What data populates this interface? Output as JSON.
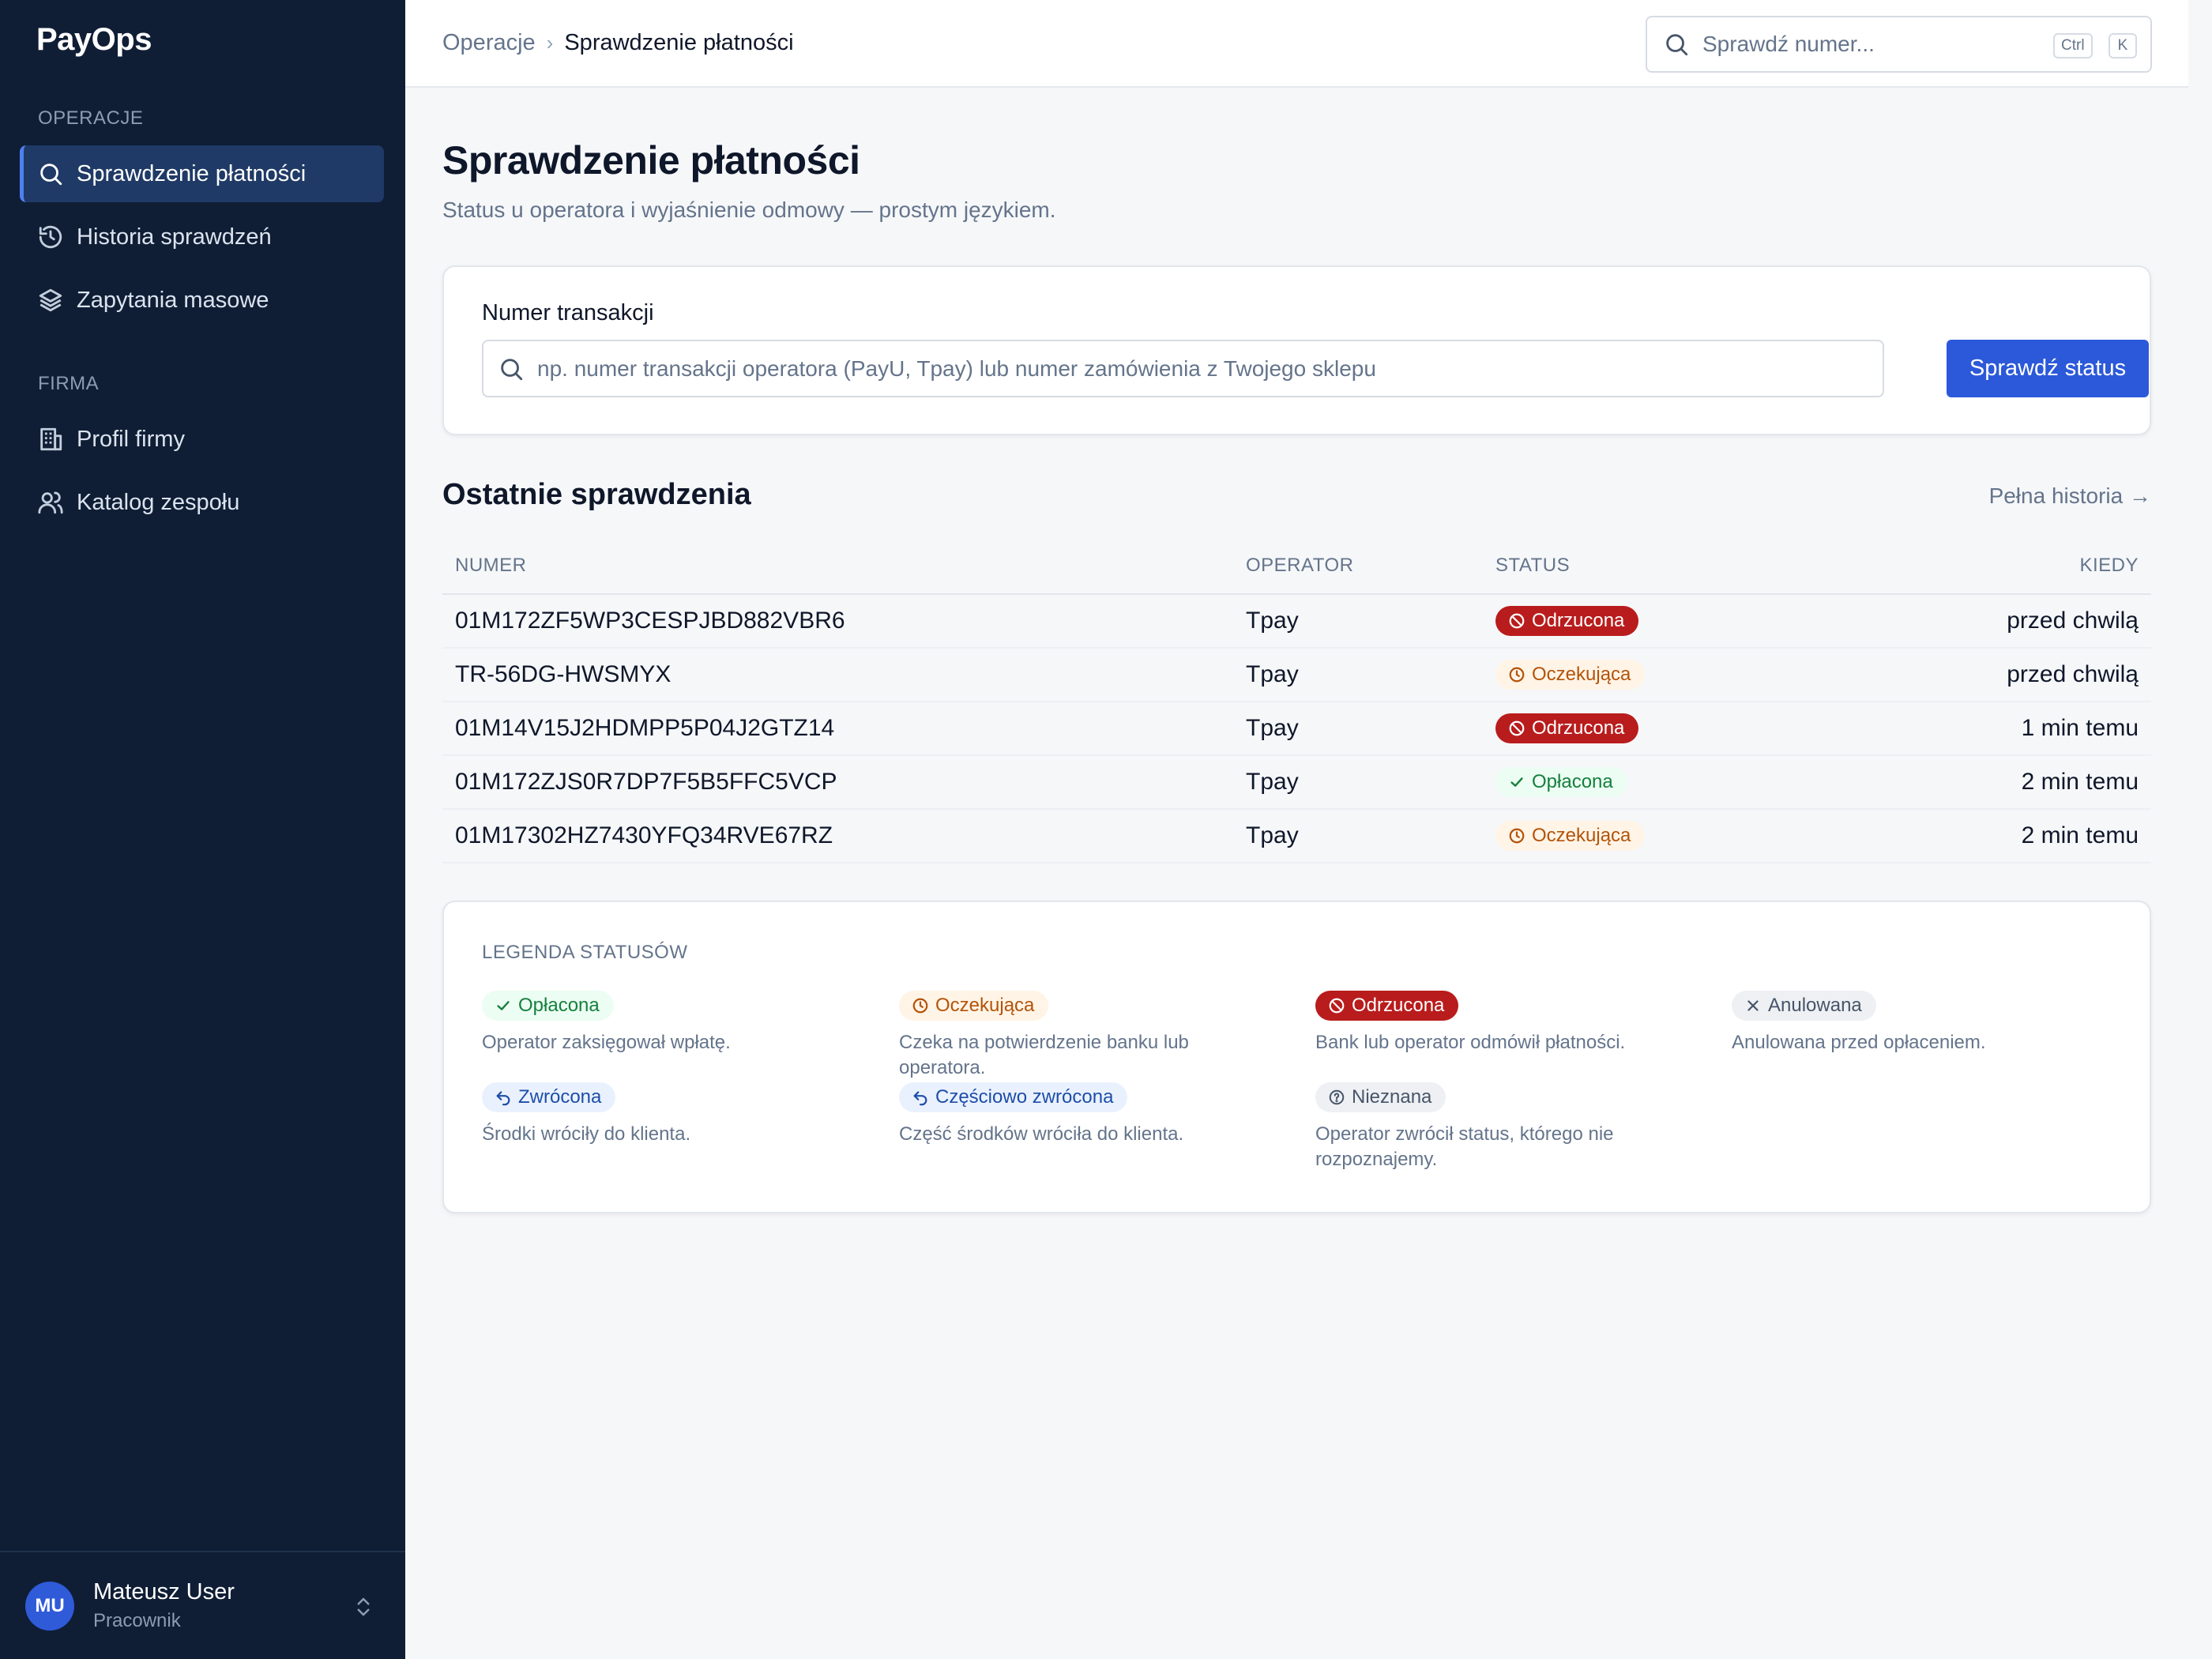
{
  "app": {
    "name": "PayOps"
  },
  "colors": {
    "sidebar_bg": "#0f1e35",
    "accent": "#2b59d9",
    "rejected": "#b91c1c",
    "pending": "#b45309",
    "paid": "#15803d"
  },
  "sidebar": {
    "sections": [
      {
        "title": "OPERACJE",
        "items": [
          {
            "label": "Sprawdzenie płatności",
            "icon": "search-icon",
            "active": true
          },
          {
            "label": "Historia sprawdzeń",
            "icon": "history-icon"
          },
          {
            "label": "Zapytania masowe",
            "icon": "layers-icon"
          }
        ]
      },
      {
        "title": "FIRMA",
        "items": [
          {
            "label": "Profil firmy",
            "icon": "building-icon"
          },
          {
            "label": "Katalog zespołu",
            "icon": "users-icon"
          }
        ]
      }
    ],
    "user": {
      "initials": "MU",
      "name": "Mateusz User",
      "role": "Pracownik"
    }
  },
  "topbar": {
    "breadcrumb": [
      "Operacje",
      "Sprawdzenie płatności"
    ],
    "search_placeholder": "Sprawdź numer...",
    "shortcut": [
      "Ctrl",
      "K"
    ]
  },
  "page": {
    "title": "Sprawdzenie płatności",
    "subtitle": "Status u operatora i wyjaśnienie odmowy — prostym językiem."
  },
  "lookup": {
    "label": "Numer transakcji",
    "placeholder": "np. numer transakcji operatora (PayU, Tpay) lub numer zamówienia z Twojego sklepu",
    "button": "Sprawdź status"
  },
  "recent": {
    "title": "Ostatnie sprawdzenia",
    "link": "Pełna historia →",
    "columns": [
      "NUMER",
      "OPERATOR",
      "STATUS",
      "KIEDY"
    ],
    "rows": [
      {
        "number": "01M172ZF5WP3CESPJBD882VBR6",
        "operator": "Tpay",
        "status": "Odrzucona",
        "kind": "rejected",
        "when": "przed chwilą"
      },
      {
        "number": "TR-56DG-HWSMYX",
        "operator": "Tpay",
        "status": "Oczekująca",
        "kind": "pending",
        "when": "przed chwilą"
      },
      {
        "number": "01M14V15J2HDMPP5P04J2GTZ14",
        "operator": "Tpay",
        "status": "Odrzucona",
        "kind": "rejected",
        "when": "1 min temu"
      },
      {
        "number": "01M172ZJS0R7DP7F5B5FFC5VCP",
        "operator": "Tpay",
        "status": "Opłacona",
        "kind": "paid",
        "when": "2 min temu"
      },
      {
        "number": "01M17302HZ7430YFQ34RVE67RZ",
        "operator": "Tpay",
        "status": "Oczekująca",
        "kind": "pending",
        "when": "2 min temu"
      }
    ]
  },
  "legend": {
    "title": "LEGENDA STATUSÓW",
    "items": [
      {
        "label": "Opłacona",
        "kind": "paid",
        "desc": "Operator zaksięgował wpłatę."
      },
      {
        "label": "Oczekująca",
        "kind": "pending",
        "desc": "Czeka na potwierdzenie banku lub operatora."
      },
      {
        "label": "Odrzucona",
        "kind": "rejected",
        "desc": "Bank lub operator odmówił płatności."
      },
      {
        "label": "Anulowana",
        "kind": "cancelled",
        "desc": "Anulowana przed opłaceniem."
      },
      {
        "label": "Zwrócona",
        "kind": "refund",
        "desc": "Środki wróciły do klienta."
      },
      {
        "label": "Częściowo zwrócona",
        "kind": "refund",
        "desc": "Część środków wróciła do klienta."
      },
      {
        "label": "Nieznana",
        "kind": "unknown",
        "desc": "Operator zwrócił status, którego nie rozpoznajemy."
      }
    ]
  }
}
